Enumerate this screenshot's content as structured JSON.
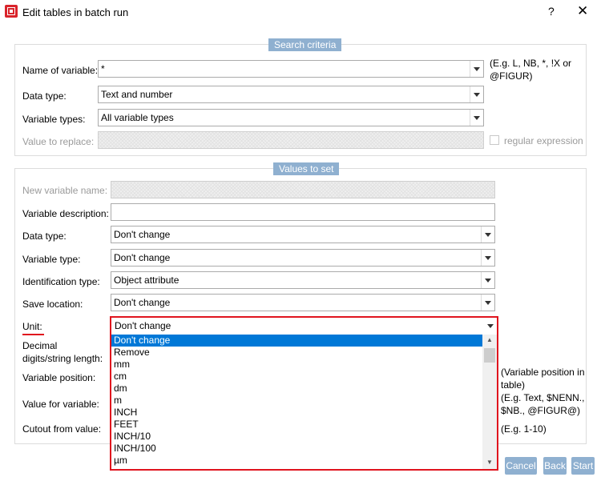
{
  "window": {
    "title": "Edit tables in batch run",
    "help_label": "?",
    "close_label": "✕"
  },
  "search": {
    "legend": "Search criteria",
    "name_label": "Name of variable:",
    "name_value": "*",
    "name_hint": "(E.g. L, NB, *, !X or @FIGUR)",
    "datatype_label": "Data type:",
    "datatype_value": "Text and number",
    "vartypes_label": "Variable types:",
    "vartypes_value": "All variable types",
    "replace_label": "Value to replace:",
    "regex_label": "regular expression"
  },
  "values": {
    "legend": "Values to set",
    "newname_label": "New variable name:",
    "desc_label": "Variable description:",
    "datatype_label": "Data type:",
    "datatype_value": "Don't change",
    "vartype_label": "Variable type:",
    "vartype_value": "Don't change",
    "idtype_label": "Identification type:",
    "idtype_value": "Object attribute",
    "saveloc_label": "Save location:",
    "saveloc_value": "Don't change",
    "unit_label": "Unit:",
    "unit_value": "Don't change",
    "decimal_label": "Decimal digits/string length:",
    "position_label": "Variable position:",
    "position_hint": "(Variable position in table)",
    "value_label": "Value for variable:",
    "value_hint": "(E.g. Text, $NENN., $NB., @FIGUR@)",
    "cutout_label": "Cutout from value:",
    "cutout_hint": "(E.g. 1-10)"
  },
  "unit_options": [
    "Don't change",
    "Remove",
    "mm",
    "cm",
    "dm",
    "m",
    "INCH",
    "FEET",
    "INCH/10",
    "INCH/100",
    "µm"
  ],
  "buttons": {
    "cancel": "Cancel",
    "back": "Back",
    "start": "Start"
  },
  "icons": {
    "app": "app-logo-icon",
    "help": "help-icon",
    "close": "close-icon",
    "dropdown": "chevron-down-icon"
  },
  "colors": {
    "accent": "#8fb0d0",
    "highlight": "#e0141e",
    "selection": "#0078d7"
  }
}
